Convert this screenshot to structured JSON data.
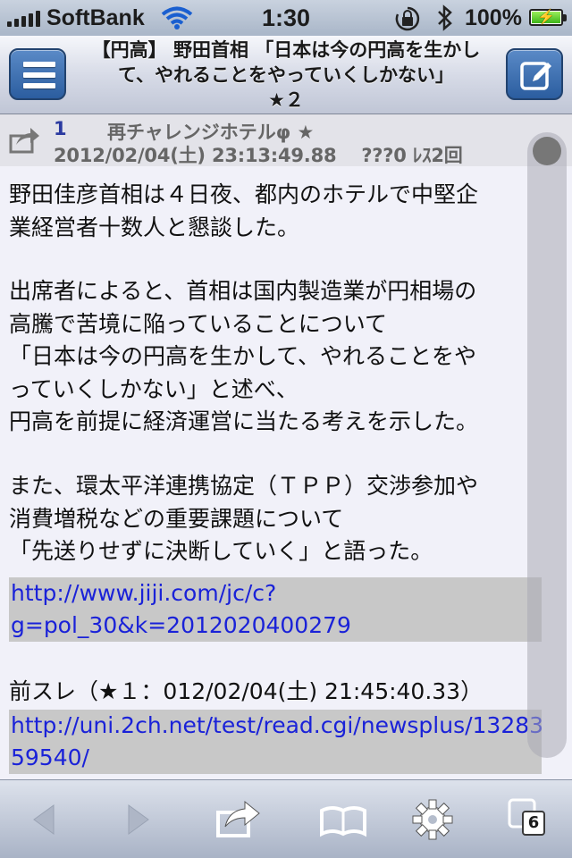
{
  "status_bar": {
    "carrier": "SoftBank",
    "time": "1:30",
    "battery_percent": "100%",
    "battery_level": 1.0
  },
  "nav": {
    "title_line1": "【円高】 野田首相 「日本は今の円高を生かし",
    "title_line2": "て、やれることをやっていくしかない」",
    "title_line3": "★２"
  },
  "post": {
    "number": "1",
    "name": "再チャレンジホテルφ ★",
    "meta": "2012/02/04(土) 23:13:49.88 　???0 ﾚｽ2回",
    "paragraph1": [
      "野田佳彦首相は４日夜、都内のホテルで中堅企",
      "業経営者十数人と懇談した。"
    ],
    "paragraph2": [
      "出席者によると、首相は国内製造業が円相場の",
      "高騰で苦境に陥っていることについて",
      "「日本は今の円高を生かして、やれることをや",
      "っていくしかない」と述べ、",
      "円高を前提に経済運営に当たる考えを示した。"
    ],
    "paragraph3": [
      "また、環太平洋連携協定（ＴＰＰ）交渉参加や",
      "消費増税などの重要課題について",
      "「先送りせずに決断していく」と語った。"
    ],
    "link1": [
      "http://www.jiji.com/jc/c?",
      "g=pol_30&k=2012020400279"
    ],
    "prev_thread": "前スレ（★１：012/02/04(土) 21:45:40.33）",
    "link2": [
      "http://uni.2ch.net/test/read.cgi/newsplus/13283",
      "59540/"
    ]
  },
  "toolbar": {
    "tab_count": "6"
  },
  "colors": {
    "link": "#1a22d8",
    "nav_button": "#3a6db0",
    "post_number": "#2b3aa0"
  }
}
